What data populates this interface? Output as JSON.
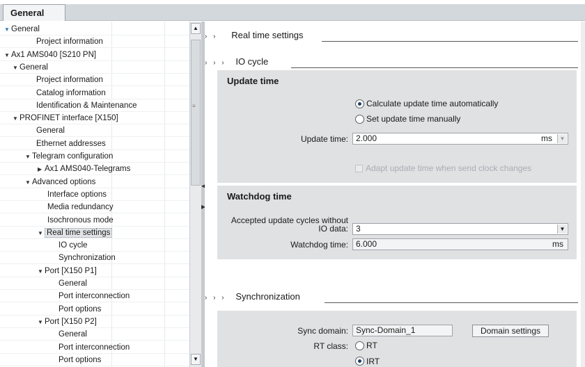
{
  "tabs": {
    "general": "General"
  },
  "tree": [
    {
      "label": "General",
      "level": 0,
      "arrow": "down-blue"
    },
    {
      "label": "Project information",
      "level": 2,
      "arrow": ""
    },
    {
      "label": "Ax1 AMS040 [S210 PN]",
      "level": 0,
      "arrow": "down"
    },
    {
      "label": "General",
      "level": 1,
      "arrow": "down"
    },
    {
      "label": "Project information",
      "level": 2,
      "arrow": ""
    },
    {
      "label": "Catalog information",
      "level": 2,
      "arrow": ""
    },
    {
      "label": "Identification & Maintenance",
      "level": 2,
      "arrow": ""
    },
    {
      "label": "PROFINET interface [X150]",
      "level": 1,
      "arrow": "down"
    },
    {
      "label": "General",
      "level": 2,
      "arrow": ""
    },
    {
      "label": "Ethernet addresses",
      "level": 2,
      "arrow": ""
    },
    {
      "label": "Telegram configuration",
      "level": 2,
      "arrow": "down"
    },
    {
      "label": "Ax1 AMS040-Telegrams",
      "level": 3,
      "arrow": "right"
    },
    {
      "label": "Advanced options",
      "level": 2,
      "arrow": "down"
    },
    {
      "label": "Interface options",
      "level": 3,
      "arrow": ""
    },
    {
      "label": "Media redundancy",
      "level": 3,
      "arrow": ""
    },
    {
      "label": "Isochronous mode",
      "level": 3,
      "arrow": ""
    },
    {
      "label": "Real time settings",
      "level": 3,
      "arrow": "down",
      "selected": true
    },
    {
      "label": "IO cycle",
      "level": 4,
      "arrow": ""
    },
    {
      "label": "Synchronization",
      "level": 4,
      "arrow": ""
    },
    {
      "label": "Port [X150 P1]",
      "level": 3,
      "arrow": "down"
    },
    {
      "label": "General",
      "level": 4,
      "arrow": ""
    },
    {
      "label": "Port interconnection",
      "level": 4,
      "arrow": ""
    },
    {
      "label": "Port options",
      "level": 4,
      "arrow": ""
    },
    {
      "label": "Port [X150 P2]",
      "level": 3,
      "arrow": "down"
    },
    {
      "label": "General",
      "level": 4,
      "arrow": ""
    },
    {
      "label": "Port interconnection",
      "level": 4,
      "arrow": ""
    },
    {
      "label": "Port options",
      "level": 4,
      "arrow": ""
    }
  ],
  "content": {
    "realtime_heading": "Real time settings",
    "iocycle_heading": "IO cycle",
    "update": {
      "title": "Update time",
      "auto_label": "Calculate update time automatically",
      "manual_label": "Set update time manually",
      "time_label": "Update time:",
      "time_value": "2.000",
      "unit": "ms",
      "adapt_label": "Adapt update time when send clock changes"
    },
    "watchdog": {
      "title": "Watchdog time",
      "cycles_label_1": "Accepted update cycles without",
      "cycles_label_2": "IO data:",
      "cycles_value": "3",
      "time_label": "Watchdog time:",
      "time_value": "6.000",
      "unit": "ms"
    },
    "sync_heading": "Synchronization",
    "sync": {
      "domain_label": "Sync domain:",
      "domain_value": "Sync-Domain_1",
      "domain_button": "Domain settings",
      "rtclass_label": "RT class:",
      "rt_label": "RT",
      "irt_label": "IRT"
    }
  }
}
